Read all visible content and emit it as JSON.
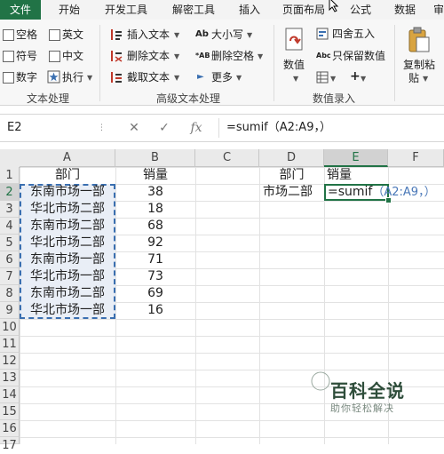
{
  "tabs": [
    "文件",
    "开始",
    "开发工具",
    "解密工具",
    "插入",
    "页面布局",
    "公式",
    "数据",
    "审"
  ],
  "ribbon": {
    "text_group": {
      "checkboxes": [
        "空格",
        "英文",
        "符号",
        "中文",
        "数字"
      ],
      "execute": "执行",
      "label": "文本处理"
    },
    "advanced_group": {
      "items": [
        "插入文本",
        "删除文本",
        "截取文本",
        "大小写",
        "删除空格",
        "更多"
      ],
      "label": "高级文本处理"
    },
    "number_group": {
      "value_label": "数值",
      "round": "四舍五入",
      "keep_value": "只保留数值",
      "label": "数值录入"
    },
    "paste": {
      "line1": "复制粘",
      "line2": "贴"
    }
  },
  "formula_bar": {
    "name_box": "E2",
    "formula": "=sumif（A2:A9，）"
  },
  "sheet": {
    "columns": [
      "A",
      "B",
      "C",
      "D",
      "E",
      "F"
    ],
    "rows": [
      "1",
      "2",
      "3",
      "4",
      "5",
      "6",
      "7",
      "8",
      "9",
      "10",
      "11",
      "12",
      "13",
      "14",
      "15",
      "16",
      "17"
    ],
    "col_a": [
      "部门",
      "东南市场一部",
      "华北市场二部",
      "东南市场二部",
      "华北市场二部",
      "东南市场一部",
      "华北市场一部",
      "东南市场二部",
      "华北市场一部"
    ],
    "col_b": [
      "销量",
      "38",
      "18",
      "68",
      "92",
      "71",
      "73",
      "69",
      "16"
    ],
    "d1": "部门",
    "e1": "销量",
    "d2": "市场二部",
    "e2_prefix": "=sumif",
    "e2_args": "（A2:A9，）"
  },
  "watermark": {
    "title": "百科全说",
    "subtitle": "助你轻松解决"
  },
  "colors": {
    "accent": "#217346",
    "selection_border": "#3a6fb0",
    "selection_fill": "#e9eef6"
  }
}
